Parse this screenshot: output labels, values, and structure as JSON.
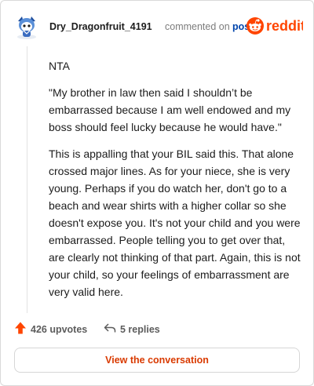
{
  "header": {
    "username": "Dry_Dragonfruit_4191",
    "commented_text": "commented on",
    "post_link": "post",
    "brand": "reddit"
  },
  "comment": {
    "paragraphs": [
      "NTA",
      "\"My brother in law then said I shouldn’t be embarrassed because I am well endowed and my boss should feel lucky because he would have.\"",
      "This is appalling that your BIL said this. That alone crossed major lines. As for your niece, she is very young. Perhaps if you do watch her, don't go to a beach and wear shirts with a higher collar so she doesn't expose you. It's not your child and you were embarrassed. People telling you to get over that, are clearly not thinking of that part. Again, this is not your child, so your feelings of embarrassment are very valid here."
    ]
  },
  "actions": {
    "upvotes": "426 upvotes",
    "replies": "5 replies"
  },
  "cta": {
    "label": "View the conversation"
  },
  "colors": {
    "brand_orange": "#ff4500",
    "link_blue": "#0045ac",
    "cta_text": "#d93a00"
  },
  "icons": {
    "upvote": "up-arrow-icon",
    "reply": "reply-arrow-icon",
    "logo": "reddit-snoo-icon"
  }
}
